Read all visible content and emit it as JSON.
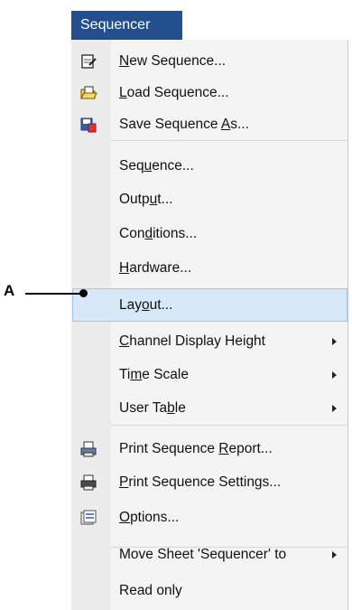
{
  "menu": {
    "title": "Sequencer",
    "items": [
      {
        "before": "",
        "u": "N",
        "after": "ew Sequence...",
        "icon": "new-sequence-icon"
      },
      {
        "before": "",
        "u": "L",
        "after": "oad Sequence...",
        "icon": "load-sequence-icon"
      },
      {
        "before": "Save Sequence ",
        "u": "A",
        "after": "s...",
        "icon": "save-sequence-icon"
      },
      {
        "before": "Seq",
        "u": "u",
        "after": "ence...",
        "icon": ""
      },
      {
        "before": "Outp",
        "u": "u",
        "after": "t...",
        "icon": ""
      },
      {
        "before": "Con",
        "u": "d",
        "after": "itions...",
        "icon": ""
      },
      {
        "before": "",
        "u": "H",
        "after": "ardware...",
        "icon": ""
      },
      {
        "before": "Lay",
        "u": "o",
        "after": "ut...",
        "icon": ""
      },
      {
        "before": "",
        "u": "C",
        "after": "hannel Display Height",
        "icon": ""
      },
      {
        "before": "Ti",
        "u": "m",
        "after": "e Scale",
        "icon": ""
      },
      {
        "before": "User Ta",
        "u": "b",
        "after": "le",
        "icon": ""
      },
      {
        "before": "Print Sequence ",
        "u": "R",
        "after": "eport...",
        "icon": "print-report-icon"
      },
      {
        "before": "",
        "u": "P",
        "after": "rint Sequence Settings...",
        "icon": "print-settings-icon"
      },
      {
        "before": "",
        "u": "O",
        "after": "ptions...",
        "icon": "options-icon"
      },
      {
        "before": "Move Sheet 'Sequencer' to",
        "u": "",
        "after": "",
        "icon": ""
      },
      {
        "before": "Read only",
        "u": "",
        "after": "",
        "icon": ""
      }
    ]
  },
  "callout": {
    "label": "A"
  },
  "colors": {
    "title_bg": "#234f8e",
    "highlight": "#d9e8f8",
    "highlight_border": "#a9c6ea"
  }
}
